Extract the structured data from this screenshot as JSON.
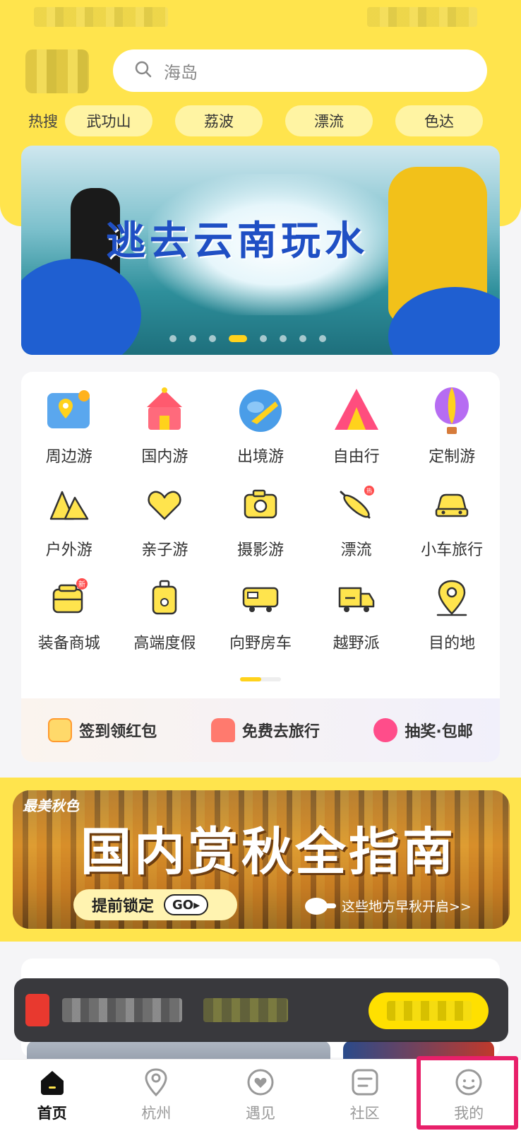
{
  "search": {
    "placeholder": "海岛"
  },
  "hot_search": {
    "label": "热搜",
    "items": [
      "武功山",
      "荔波",
      "漂流",
      "色达"
    ]
  },
  "banner_main": {
    "title": "逃去云南玩水",
    "slide_count": 8,
    "active_slide": 3
  },
  "categories": {
    "row1": [
      "周边游",
      "国内游",
      "出境游",
      "自由行",
      "定制游"
    ],
    "row2": [
      "户外游",
      "亲子游",
      "摄影游",
      "漂流",
      "小车旅行"
    ],
    "row3": [
      "装备商城",
      "高端度假",
      "向野房车",
      "越野派",
      "目的地"
    ],
    "badges": {
      "new": "新",
      "hot": "热"
    }
  },
  "promos": [
    "签到领红包",
    "免费去旅行",
    "抽奖·包邮"
  ],
  "banner_autumn": {
    "tag": "最美秋色",
    "title": "国内赏秋全指南",
    "lock_label": "提前锁定",
    "go_label": "GO▸",
    "early_text": "这些地方早秋开启>>"
  },
  "bottom_nav": [
    {
      "label": "首页",
      "icon": "home-icon"
    },
    {
      "label": "杭州",
      "icon": "location-pin-icon"
    },
    {
      "label": "遇见",
      "icon": "heart-circle-icon"
    },
    {
      "label": "社区",
      "icon": "community-icon"
    },
    {
      "label": "我的",
      "icon": "profile-icon"
    }
  ],
  "colors": {
    "brand_yellow": "#ffe44d",
    "highlight_pink": "#e8206a"
  }
}
